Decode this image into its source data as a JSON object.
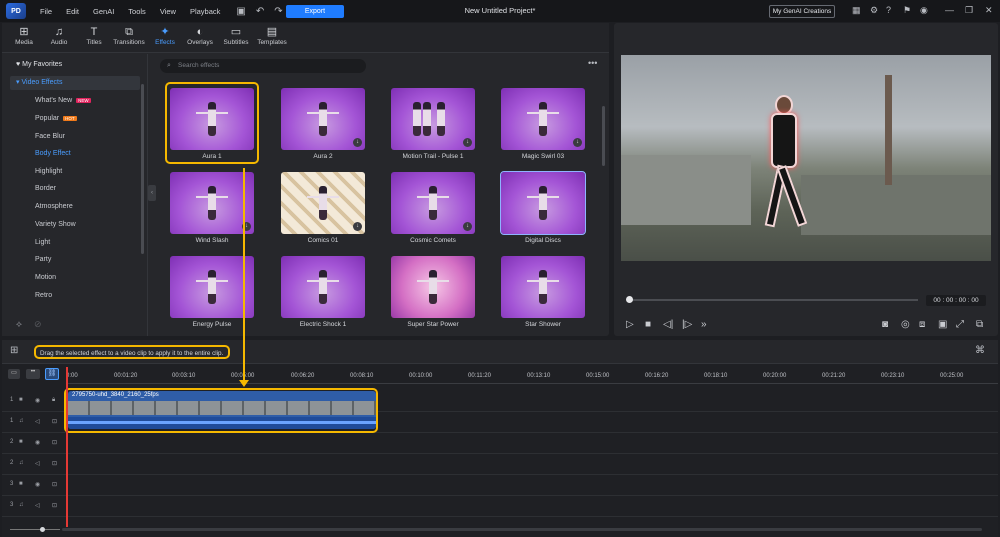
{
  "menubar": {
    "logo_text": "PD",
    "items": [
      "File",
      "Edit",
      "GenAI",
      "Tools",
      "View",
      "Playback"
    ],
    "export_label": "Export",
    "project_title": "New Untitled Project*",
    "genai_button": "My GenAI Creations"
  },
  "tabs": [
    {
      "label": "Media",
      "icon": "media-icon"
    },
    {
      "label": "Audio",
      "icon": "music-icon"
    },
    {
      "label": "Titles",
      "icon": "title-icon"
    },
    {
      "label": "Transitions",
      "icon": "transition-icon"
    },
    {
      "label": "Effects",
      "icon": "effects-icon",
      "active": true
    },
    {
      "label": "Overlays",
      "icon": "overlay-icon"
    },
    {
      "label": "Subtitles",
      "icon": "subtitles-icon"
    },
    {
      "label": "Templates",
      "icon": "templates-icon"
    }
  ],
  "sidebar": {
    "favorites": "My Favorites",
    "category_header": "Video Effects",
    "categories": [
      {
        "label": "What's New",
        "badge": "NEW"
      },
      {
        "label": "Popular",
        "badge": "HOT"
      },
      {
        "label": "Face Blur"
      },
      {
        "label": "Body Effect",
        "active": true
      },
      {
        "label": "Highlight"
      },
      {
        "label": "Border"
      },
      {
        "label": "Atmosphere"
      },
      {
        "label": "Variety Show"
      },
      {
        "label": "Light"
      },
      {
        "label": "Party"
      },
      {
        "label": "Motion"
      },
      {
        "label": "Retro"
      }
    ]
  },
  "search": {
    "placeholder": "Search effects"
  },
  "effects": [
    {
      "label": "Aura 1"
    },
    {
      "label": "Aura 2"
    },
    {
      "label": "Motion Trail - Pulse 1"
    },
    {
      "label": "Magic Swirl 03"
    },
    {
      "label": "Wind Slash"
    },
    {
      "label": "Comics 01"
    },
    {
      "label": "Cosmic Comets"
    },
    {
      "label": "Digital Discs"
    },
    {
      "label": "Energy Pulse"
    },
    {
      "label": "Electric Shock 1"
    },
    {
      "label": "Super Star Power"
    },
    {
      "label": "Star Shower"
    }
  ],
  "preview": {
    "timecode": "00 : 00 : 00 : 00"
  },
  "timeline": {
    "hint": "Drag the selected effect to a video clip to apply it to the entire clip.",
    "ticks": [
      "0:00",
      "00:01:20",
      "00:03:10",
      "00:05:00",
      "00:06:20",
      "00:08:10",
      "00:10:00",
      "00:11:20",
      "00:13:10",
      "00:15:00",
      "00:16:20",
      "00:18:10",
      "00:20:00",
      "00:21:20",
      "00:23:10",
      "00:25:00"
    ],
    "clip_name": "2795750-uhd_3840_2160_25fps",
    "tracks": [
      "1",
      "1",
      "2",
      "2",
      "3",
      "3"
    ]
  },
  "colors": {
    "accent": "#1f7cff",
    "highlight": "#f5b800",
    "active_text": "#4a9dff"
  }
}
